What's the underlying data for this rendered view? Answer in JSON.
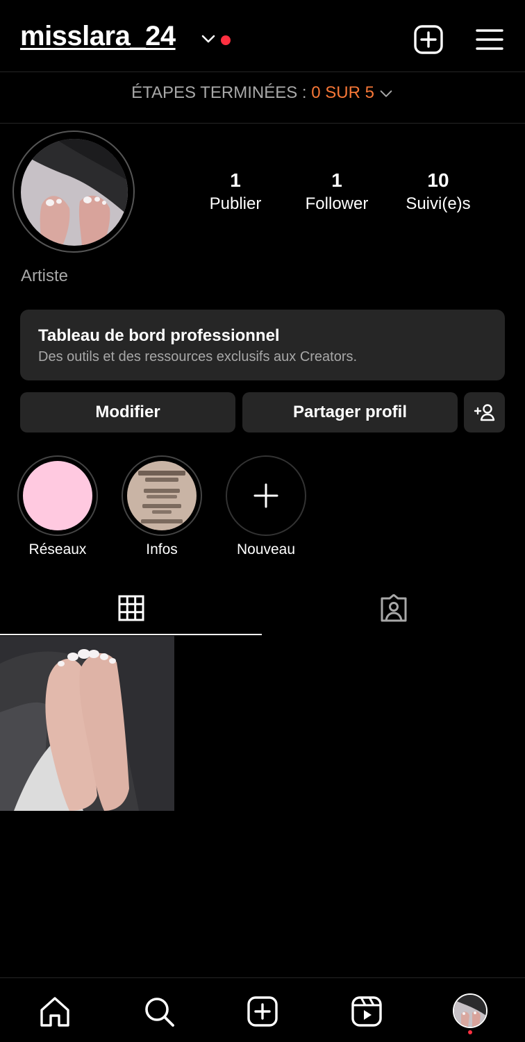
{
  "header": {
    "username": "misslara_24",
    "add_icon": "plus-square-icon",
    "menu_icon": "hamburger-menu-icon"
  },
  "steps": {
    "label": "ÉTAPES TERMINÉES : ",
    "progress": "0 SUR 5"
  },
  "profile": {
    "stats": [
      {
        "count": "1",
        "label": "Publier"
      },
      {
        "count": "1",
        "label": "Follower"
      },
      {
        "count": "10",
        "label": "Suivi(e)s"
      }
    ],
    "category": "Artiste"
  },
  "dashboard": {
    "title": "Tableau de bord professionnel",
    "subtitle": "Des outils et des ressources exclusifs aux Creators."
  },
  "buttons": {
    "edit": "Modifier",
    "share": "Partager profil"
  },
  "highlights": [
    {
      "label": "Réseaux"
    },
    {
      "label": "Infos"
    },
    {
      "label": "Nouveau"
    }
  ],
  "tabs": [
    "grid-icon",
    "tagged-icon"
  ],
  "bottom_nav": [
    "home-icon",
    "search-icon",
    "create-icon",
    "reels-icon",
    "profile-avatar"
  ],
  "colors": {
    "accent_orange": "#f77737",
    "notification_red": "#ff3040",
    "card_gray": "#262626",
    "highlight_pink": "#ffc9e0"
  }
}
